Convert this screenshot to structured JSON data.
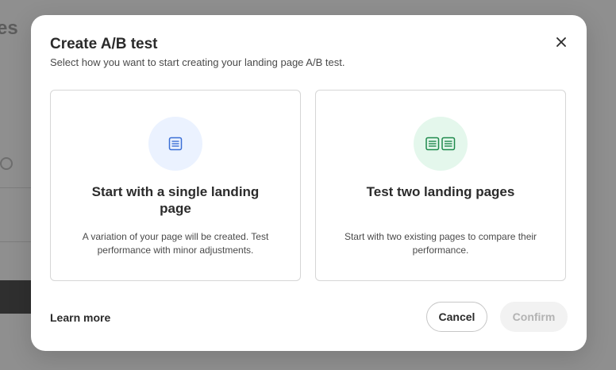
{
  "modal": {
    "title": "Create A/B test",
    "subtitle": "Select how you want to start creating your landing page A/B test.",
    "close_icon": "close-icon",
    "options": [
      {
        "title": "Start with a single landing page",
        "description": "A variation of your page will be created. Test performance with minor adjustments.",
        "icon": "single-page-icon",
        "accent": "#3b6fd6",
        "icon_bg": "#ebf2ff"
      },
      {
        "title": "Test two landing pages",
        "description": "Start with two existing pages to compare their performance.",
        "icon": "two-pages-icon",
        "accent": "#1f8a4c",
        "icon_bg": "#e4f7ec"
      }
    ],
    "learn_more": "Learn more",
    "cancel_label": "Cancel",
    "confirm_label": "Confirm"
  }
}
